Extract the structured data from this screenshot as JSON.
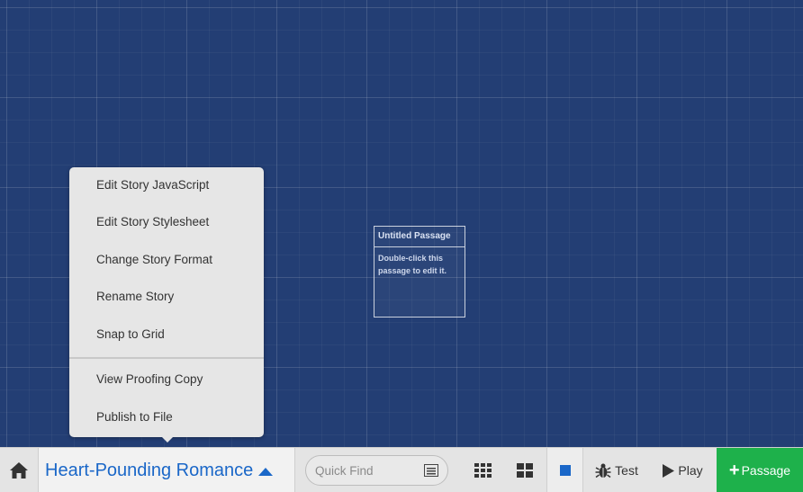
{
  "canvas": {
    "passages": [
      {
        "title": "Untitled Passage",
        "excerpt": "Double-click this passage to edit it."
      }
    ]
  },
  "menu": {
    "items": [
      "Edit Story JavaScript",
      "Edit Story Stylesheet",
      "Change Story Format",
      "Rename Story",
      "Snap to Grid",
      "View Proofing Copy",
      "Publish to File"
    ]
  },
  "toolbar": {
    "story_name": "Heart-Pounding Romance",
    "quick_find_placeholder": "Quick Find",
    "test_label": "Test",
    "play_label": "Play",
    "passage_label": "Passage"
  },
  "icons": {
    "home": "home-icon",
    "caret": "caret-up-icon",
    "quick_find_options": "list-options-icon",
    "passage_detail": "grid-detail-icon",
    "passage_compact": "grid-compact-icon",
    "highlight": "square-highlight-icon",
    "test": "bug-icon",
    "play": "play-icon",
    "add_passage": "plus-icon"
  },
  "colors": {
    "canvas_bg": "#233e74",
    "accent_blue": "#1a67c8",
    "passage_button_green": "#1eb14b",
    "toolbar_bg": "#e4e4e4",
    "menu_bg": "#e6e6e6"
  }
}
